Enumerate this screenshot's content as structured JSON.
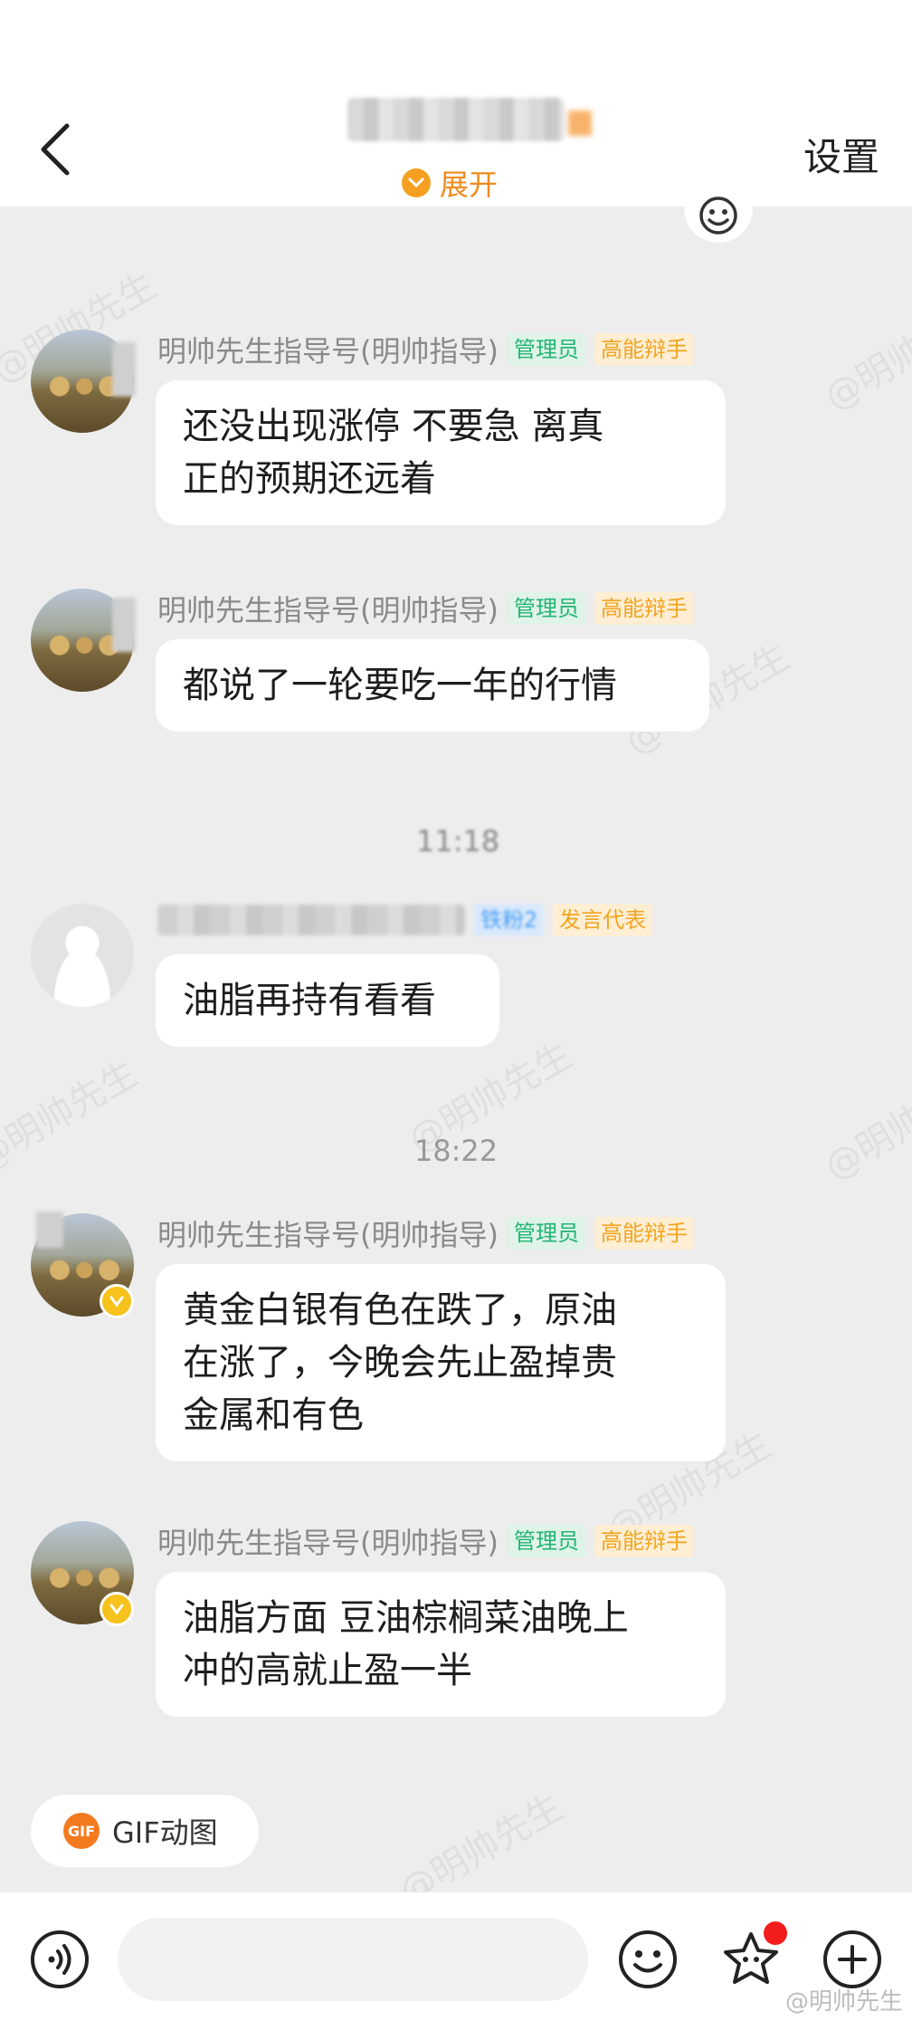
{
  "header": {
    "back_label": "back",
    "expand_label": "展开",
    "settings_label": "设置"
  },
  "watermark": "@明帅先生",
  "messages": [
    {
      "sender": "明帅先生指导号(明帅指导)",
      "tags": [
        "管理员",
        "高能辩手"
      ],
      "text_lines": [
        "还没出现涨停  不要急  离真",
        "正的预期还远着"
      ]
    },
    {
      "sender": "明帅先生指导号(明帅指导)",
      "tags": [
        "管理员",
        "高能辩手"
      ],
      "text_lines": [
        "都说了一轮要吃一年的行情"
      ]
    },
    {
      "sender": "",
      "tags": [
        "铁粉2",
        "发言代表"
      ],
      "text_lines": [
        "油脂再持有看看"
      ]
    },
    {
      "sender": "明帅先生指导号(明帅指导)",
      "tags": [
        "管理员",
        "高能辩手"
      ],
      "text_lines": [
        "黄金白银有色在跌了，原油",
        "在涨了，今晚会先止盈掉贵",
        "金属和有色"
      ]
    },
    {
      "sender": "明帅先生指导号(明帅指导)",
      "tags": [
        "管理员",
        "高能辩手"
      ],
      "text_lines": [
        "油脂方面 豆油棕榈菜油晚上",
        "冲的高就止盈一半"
      ]
    }
  ],
  "timestamps": {
    "blurred": "11:18",
    "main": "18:22"
  },
  "gif_button": {
    "icon_text": "GIF",
    "label": "GIF动图"
  },
  "input": {
    "placeholder": ""
  },
  "footer_watermark": "@明帅先生",
  "colors": {
    "accent_orange": "#f08a1c",
    "admin_green": "#22b573",
    "elite_gold": "#f2a51f",
    "badge_red": "#f41d1d"
  }
}
